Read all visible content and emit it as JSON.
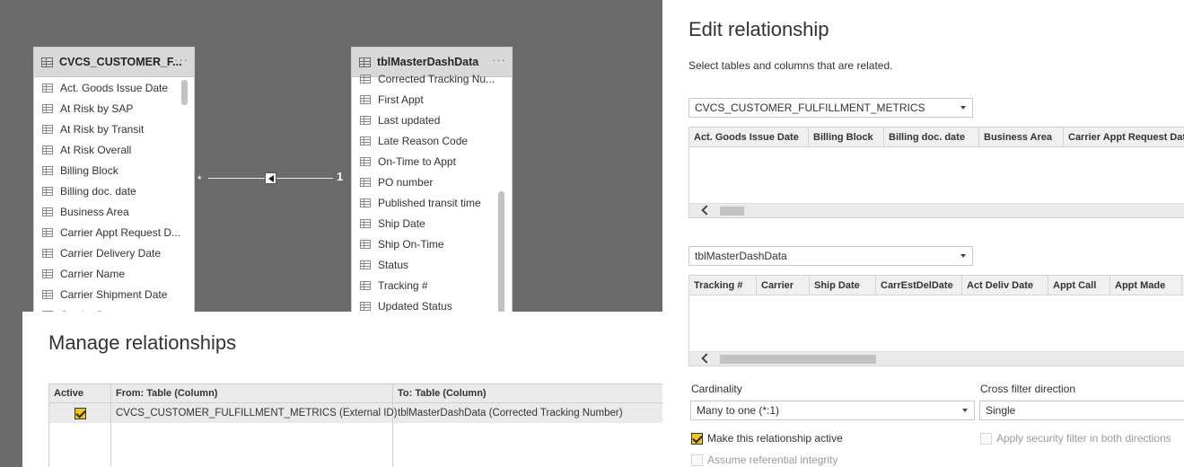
{
  "model": {
    "left_table": {
      "title": "CVCS_CUSTOMER_F...",
      "fields": [
        "Act. Goods Issue Date",
        "At Risk by SAP",
        "At Risk by Transit",
        "At Risk Overall",
        "Billing Block",
        "Billing doc. date",
        "Business Area",
        "Carrier Appt Request D...",
        "Carrier Delivery Date",
        "Carrier Name",
        "Carrier Shipment Date",
        "Carrier Status"
      ]
    },
    "right_table": {
      "title": "tblMasterDashData",
      "fields": [
        "Corrected Tracking Nu...",
        "First Appt",
        "Last updated",
        "Late Reason Code",
        "On-Time to Appt",
        "PO number",
        "Published transit time",
        "Ship Date",
        "Ship On-Time",
        "Status",
        "Tracking #",
        "Updated Status"
      ]
    },
    "relationship": {
      "many_symbol": "*",
      "one_symbol": "1"
    },
    "more_icon": "···"
  },
  "manage": {
    "title": "Manage relationships",
    "headers": [
      "Active",
      "From: Table (Column)",
      "To: Table (Column)"
    ],
    "rows": [
      {
        "active": true,
        "from": "CVCS_CUSTOMER_FULFILLMENT_METRICS (External ID)",
        "to": "tblMasterDashData (Corrected Tracking Number)"
      }
    ]
  },
  "edit": {
    "title": "Edit relationship",
    "subtitle": "Select tables and columns that are related.",
    "table1": {
      "name": "CVCS_CUSTOMER_FULFILLMENT_METRICS",
      "columns": [
        "Act. Goods Issue Date",
        "Billing Block",
        "Billing doc. date",
        "Business Area",
        "Carrier Appt Request Date"
      ]
    },
    "table2": {
      "name": "tblMasterDashData",
      "columns": [
        "Tracking #",
        "Carrier",
        "Ship Date",
        "CarrEstDelDate",
        "Act Deliv Date",
        "Appt Call",
        "Appt Made"
      ]
    },
    "cardinality_label": "Cardinality",
    "cardinality_value": "Many to one (*:1)",
    "cross_filter_label": "Cross filter direction",
    "cross_filter_value": "Single",
    "make_active_label": "Make this relationship active",
    "make_active_checked": true,
    "security_filter_label": "Apply security filter in both directions",
    "security_filter_checked": false,
    "referential_label": "Assume referential integrity",
    "referential_checked": false
  },
  "colors": {
    "accent_checkbox": "#f2c811",
    "canvas": "#6b6b6b"
  }
}
